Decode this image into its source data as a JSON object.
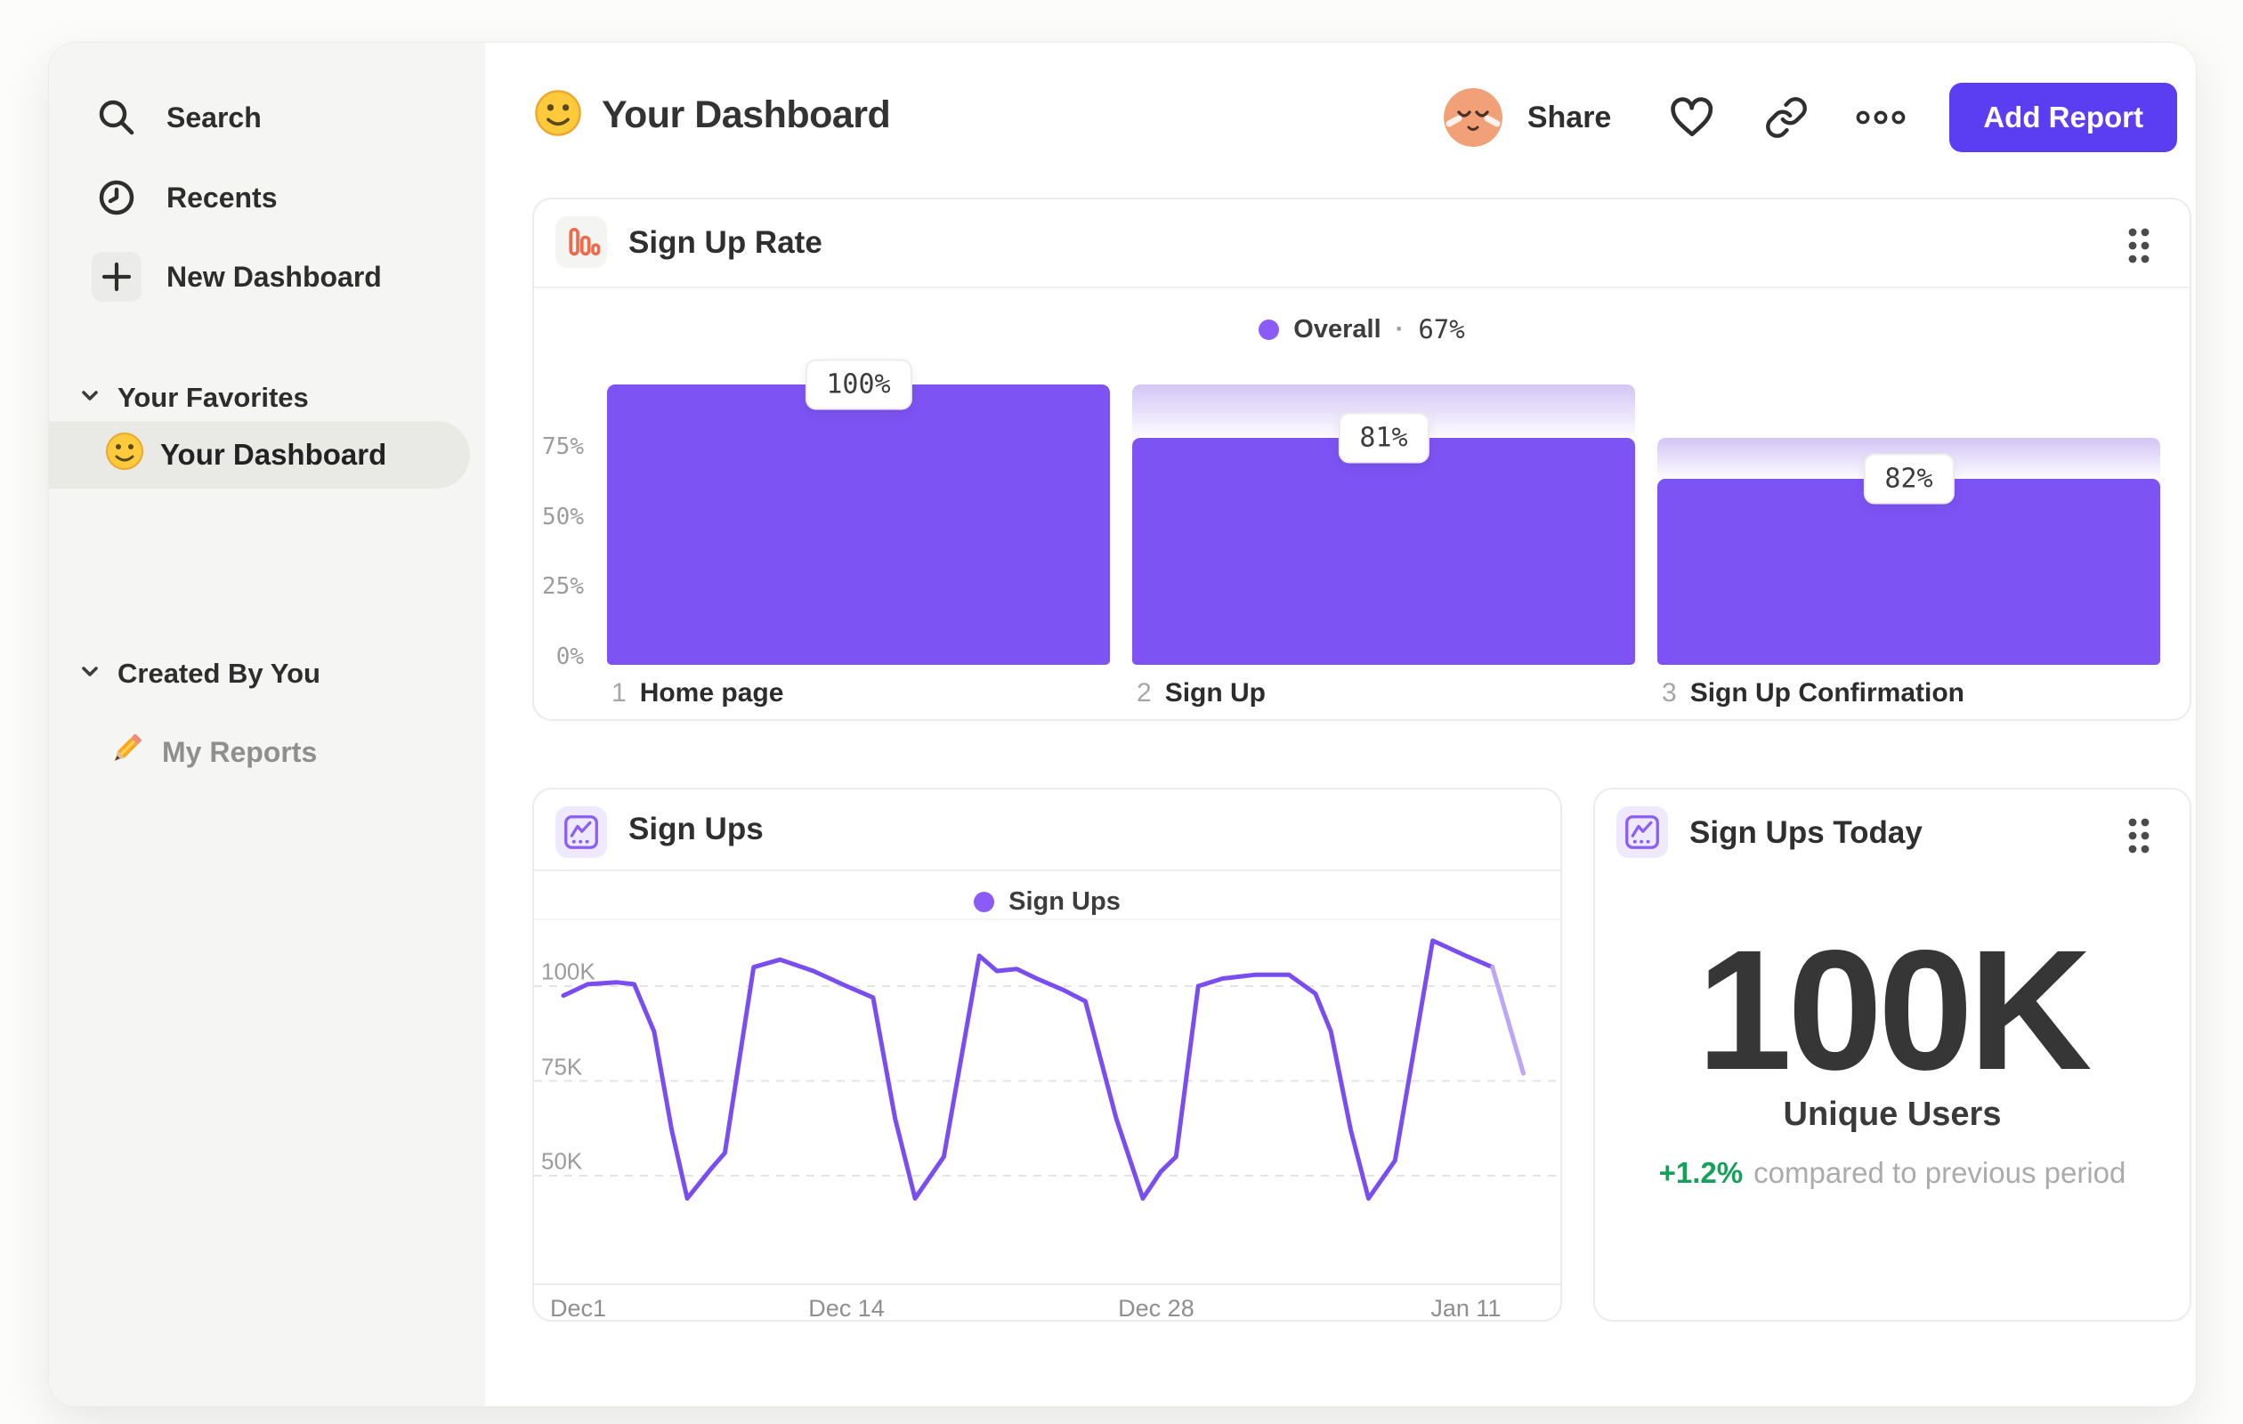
{
  "sidebar": {
    "items": [
      {
        "label": "Search",
        "icon": "search-icon"
      },
      {
        "label": "Recents",
        "icon": "clock-icon"
      },
      {
        "label": "New Dashboard",
        "icon": "plus-icon"
      }
    ],
    "sections": [
      {
        "label": "Your Favorites"
      },
      {
        "label": "Created By You"
      }
    ],
    "favorites_items": [
      {
        "label": "Your Dashboard",
        "icon": "smiley-emoji",
        "selected": true
      }
    ],
    "created_items": [
      {
        "label": "My Reports",
        "icon": "pencil-emoji"
      }
    ]
  },
  "header": {
    "title": "Your Dashboard",
    "title_emoji": "slightly-smiling-face",
    "share_label": "Share",
    "add_report_label": "Add Report"
  },
  "chart_data": [
    {
      "type": "bar",
      "variant": "funnel-conversion",
      "title": "Sign Up Rate",
      "legend": {
        "label": "Overall",
        "separator": "·",
        "value": "67%"
      },
      "y_axis": {
        "ticks": [
          {
            "label": "75%",
            "pct": 75
          },
          {
            "label": "50%",
            "pct": 50
          },
          {
            "label": "25%",
            "pct": 25
          },
          {
            "label": "0%",
            "pct": 0
          }
        ]
      },
      "steps": [
        {
          "num": "1",
          "label": "Home page",
          "conversion_label": "100%",
          "conversion_pct": 100,
          "cumulative_pct": 100
        },
        {
          "num": "2",
          "label": "Sign Up",
          "conversion_label": "81%",
          "conversion_pct": 81,
          "cumulative_pct": 81
        },
        {
          "num": "3",
          "label": "Sign Up Confirmation",
          "conversion_label": "82%",
          "conversion_pct": 82,
          "cumulative_pct": 66.4
        }
      ],
      "colors": {
        "bar": "#7d53f3",
        "legend_dot": "#8a5bf6",
        "gradient_top": "#d3c5f5",
        "gradient_bottom": "#fdfcff"
      }
    },
    {
      "type": "line",
      "title": "Sign Ups",
      "legend": {
        "label": "Sign Ups"
      },
      "x_axis": {
        "ticks": [
          {
            "label": "Dec1",
            "day": 0,
            "align": "left"
          },
          {
            "label": "Dec 14",
            "day": 13
          },
          {
            "label": "Dec 28",
            "day": 27
          },
          {
            "label": "Jan 11",
            "day": 41
          }
        ]
      },
      "y_axis": {
        "unit": "K",
        "range": [
          22,
          118
        ],
        "ticks": [
          {
            "label": "100K",
            "value": 100
          },
          {
            "label": "75K",
            "value": 75
          },
          {
            "label": "50K",
            "value": 50
          }
        ]
      },
      "series": [
        {
          "name": "Sign Ups",
          "unit": "K users per day",
          "faded_tail_points": 1,
          "points": [
            [
              0.2,
              97.5
            ],
            [
              1.3,
              100.5
            ],
            [
              2.6,
              101
            ],
            [
              3.4,
              100.5
            ],
            [
              4.3,
              88
            ],
            [
              5.1,
              62
            ],
            [
              5.8,
              44
            ],
            [
              6.9,
              52
            ],
            [
              7.5,
              56
            ],
            [
              8.8,
              105
            ],
            [
              10,
              107
            ],
            [
              11.5,
              104
            ],
            [
              13,
              100
            ],
            [
              14.2,
              97
            ],
            [
              15.2,
              65
            ],
            [
              16.1,
              44
            ],
            [
              17.4,
              55
            ],
            [
              19,
              108
            ],
            [
              19.8,
              104
            ],
            [
              20.7,
              104.5
            ],
            [
              21.6,
              102
            ],
            [
              22.8,
              99
            ],
            [
              23.8,
              96
            ],
            [
              25.2,
              65
            ],
            [
              26.4,
              44
            ],
            [
              27.2,
              51
            ],
            [
              27.9,
              55
            ],
            [
              28.9,
              100
            ],
            [
              30,
              102
            ],
            [
              31.5,
              103
            ],
            [
              33,
              103
            ],
            [
              34.2,
              98
            ],
            [
              34.9,
              88
            ],
            [
              35.8,
              62
            ],
            [
              36.6,
              44
            ],
            [
              37.8,
              54
            ],
            [
              39.5,
              112
            ],
            [
              41,
              108
            ],
            [
              42.2,
              105
            ],
            [
              43.6,
              77
            ]
          ]
        }
      ],
      "grid": "dashed-horizontal",
      "legend_position": "top-center",
      "colors": {
        "line": "#7a4df0",
        "line_faded": "#bda6f7",
        "legend_dot": "#8a5bf6"
      }
    },
    {
      "type": "metric",
      "title": "Sign Ups Today",
      "value": "100K",
      "label": "Unique Users",
      "delta": "+1.2%",
      "delta_note": "compared to previous period",
      "colors": {
        "delta": "#17a05c"
      }
    }
  ]
}
